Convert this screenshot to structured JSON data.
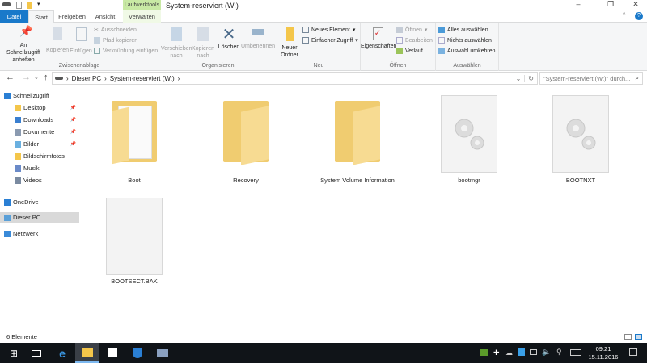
{
  "window": {
    "title": "System-reserviert (W:)",
    "context_tab": "Laufwerktools",
    "minimize": "–",
    "restore": "❐",
    "close": "✕",
    "help": "?"
  },
  "tabs": [
    {
      "label": "Datei"
    },
    {
      "label": "Start"
    },
    {
      "label": "Freigeben"
    },
    {
      "label": "Ansicht"
    },
    {
      "label": "Verwalten"
    }
  ],
  "ribbon": {
    "clipboard": {
      "label": "Zwischenablage",
      "pin": "An Schnellzugriff anheften",
      "copy": "Kopieren",
      "paste": "Einfügen",
      "cut": "Ausschneiden",
      "copy_path": "Pfad kopieren",
      "paste_shortcut": "Verknüpfung einfügen"
    },
    "organize": {
      "label": "Organisieren",
      "move": "Verschieben nach",
      "copy_to": "Kopieren nach",
      "delete": "Löschen",
      "rename": "Umbenennen"
    },
    "new": {
      "label": "Neu",
      "new_folder": "Neuer Ordner",
      "new_item": "Neues Element",
      "easy_access": "Einfacher Zugriff"
    },
    "open": {
      "label": "Öffnen",
      "properties": "Eigenschaften",
      "open": "Öffnen",
      "edit": "Bearbeiten",
      "history": "Verlauf"
    },
    "select": {
      "label": "Auswählen",
      "all": "Alles auswählen",
      "none": "Nichts auswählen",
      "invert": "Auswahl umkehren"
    }
  },
  "address": {
    "crumbs": [
      "Dieser PC",
      "System-reserviert (W:)"
    ],
    "search_placeholder": "\"System-reserviert (W:)\" durch..."
  },
  "sidebar": [
    {
      "label": "Schnellzugriff",
      "icon": "star-icon",
      "pinned": false
    },
    {
      "label": "Desktop",
      "icon": "folder-icon",
      "pinned": true
    },
    {
      "label": "Downloads",
      "icon": "download-icon",
      "pinned": true
    },
    {
      "label": "Dokumente",
      "icon": "document-icon",
      "pinned": true
    },
    {
      "label": "Bilder",
      "icon": "pictures-icon",
      "pinned": true
    },
    {
      "label": "Bildschirmfotos",
      "icon": "folder-icon",
      "pinned": false
    },
    {
      "label": "Musik",
      "icon": "music-icon",
      "pinned": false
    },
    {
      "label": "Videos",
      "icon": "video-icon",
      "pinned": false
    },
    {
      "label": "OneDrive",
      "icon": "cloud-icon",
      "pinned": false
    },
    {
      "label": "Dieser PC",
      "icon": "computer-icon",
      "pinned": false,
      "selected": true
    },
    {
      "label": "Netzwerk",
      "icon": "network-icon",
      "pinned": false
    }
  ],
  "files": [
    {
      "name": "Boot",
      "type": "folder-docs"
    },
    {
      "name": "Recovery",
      "type": "folder"
    },
    {
      "name": "System Volume Information",
      "type": "folder"
    },
    {
      "name": "bootmgr",
      "type": "system-file"
    },
    {
      "name": "BOOTNXT",
      "type": "system-file"
    },
    {
      "name": "BOOTSECT.BAK",
      "type": "file"
    }
  ],
  "status": {
    "count": "6 Elemente"
  },
  "taskbar": {
    "time": "09:21",
    "date": "15.11.2016"
  },
  "colors": {
    "accent": "#1979ca",
    "context": "#c8e9a4",
    "folder": "#f4d27a",
    "taskbar": "#101418"
  }
}
